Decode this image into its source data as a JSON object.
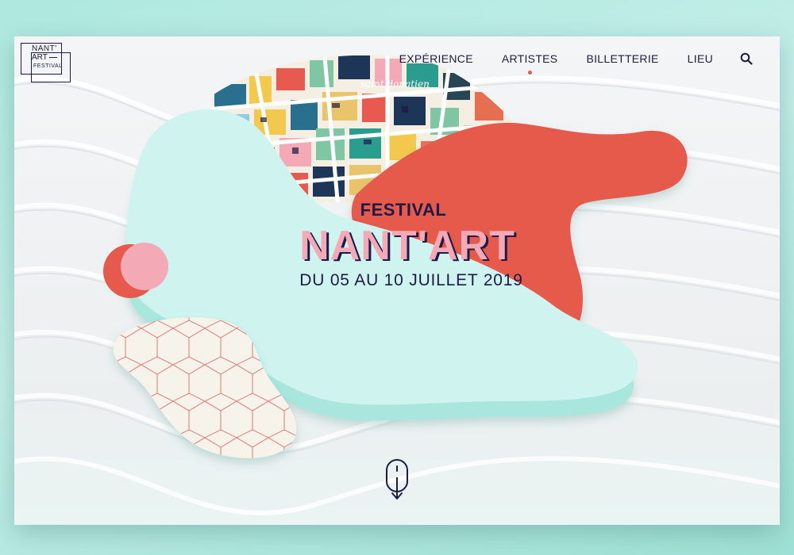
{
  "logo": {
    "line1": "NANT'",
    "line2": "ART",
    "line3": "FESTIVAL"
  },
  "nav": {
    "items": [
      {
        "label": "EXPÉRIENCE"
      },
      {
        "label": "ARTISTES",
        "active": true
      },
      {
        "label": "BILLETTERIE"
      },
      {
        "label": "LIEU"
      }
    ],
    "search_icon": "search-icon"
  },
  "map_labels": {
    "neighborhood": "saint donatien"
  },
  "hero": {
    "label": "FESTIVAL",
    "title": "NANT'ART",
    "dates": "DU 05 AU 10 JUILLET 2019"
  },
  "scroll_icon": "mouse-scroll-icon",
  "colors": {
    "navy": "#1c1b47",
    "coral": "#e55a4c",
    "pink": "#f4a9b6",
    "mint": "#c8f1ec",
    "mint_dark": "#9fe1d6",
    "accent_dot": "#e55a4c"
  }
}
